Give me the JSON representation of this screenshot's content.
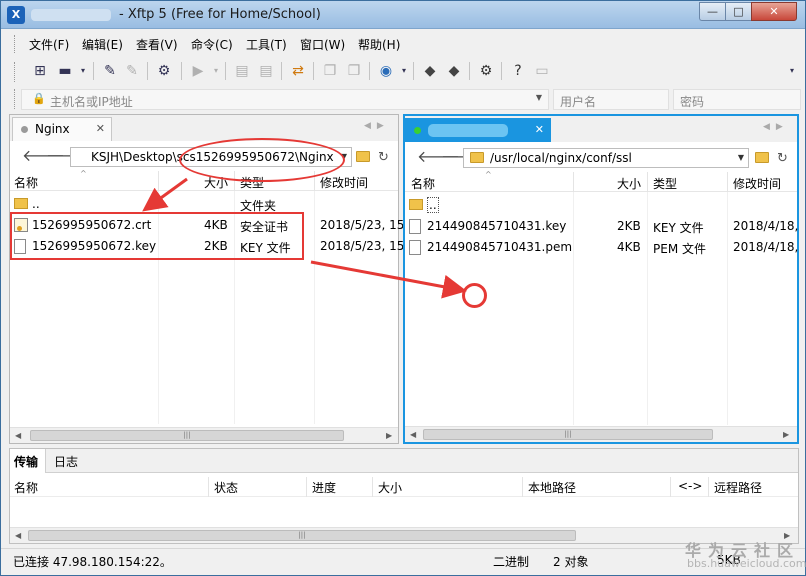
{
  "window": {
    "title": "- Xftp 5 (Free for Home/School)",
    "app_icon_glyph": "X",
    "controls": {
      "minimize": "—",
      "maximize": "□",
      "close": "✕"
    }
  },
  "menu": [
    "文件(F)",
    "编辑(E)",
    "查看(V)",
    "命令(C)",
    "工具(T)",
    "窗口(W)",
    "帮助(H)"
  ],
  "address": {
    "host_placeholder": "主机名或IP地址",
    "user_placeholder": "用户名",
    "pass_placeholder": "密码"
  },
  "left": {
    "tab_label": "Nginx",
    "path": "KSJH\\Desktop\\scs1526995950672\\Nginx",
    "columns": {
      "name": "名称",
      "size": "大小",
      "type": "类型",
      "modified": "修改时间"
    },
    "rows": [
      {
        "name": "..",
        "size": "",
        "type": "文件夹",
        "modified": "",
        "icon": "folder-icon"
      },
      {
        "name": "1526995950672.crt",
        "size": "4KB",
        "type": "安全证书",
        "modified": "2018/5/23, 15",
        "icon": "certificate-icon"
      },
      {
        "name": "1526995950672.key",
        "size": "2KB",
        "type": "KEY 文件",
        "modified": "2018/5/23, 15",
        "icon": "file-icon"
      }
    ]
  },
  "right": {
    "path": "/usr/local/nginx/conf/ssl",
    "columns": {
      "name": "名称",
      "size": "大小",
      "type": "类型",
      "modified": "修改时间"
    },
    "rows": [
      {
        "name": "..",
        "size": "",
        "type": "",
        "modified": "",
        "icon": "folder-icon"
      },
      {
        "name": "214490845710431.key",
        "size": "2KB",
        "type": "KEY 文件",
        "modified": "2018/4/18,",
        "icon": "file-icon"
      },
      {
        "name": "214490845710431.pem",
        "size": "4KB",
        "type": "PEM 文件",
        "modified": "2018/4/18,",
        "icon": "file-icon"
      }
    ]
  },
  "transfer": {
    "tabs": [
      "传输",
      "日志"
    ],
    "columns": [
      "名称",
      "状态",
      "进度",
      "大小",
      "本地路径",
      "<->",
      "远程路径"
    ]
  },
  "status": {
    "connection": "已连接 47.98.180.154:22。",
    "mode": "二进制",
    "objects": "2 对象",
    "size": "5KB"
  },
  "watermark": {
    "text": "华为云社区",
    "url": "bbs.huaweicloud.com"
  },
  "colors": {
    "accent": "#1a95e0",
    "annotation": "#e53935",
    "connected": "#3ad030"
  }
}
